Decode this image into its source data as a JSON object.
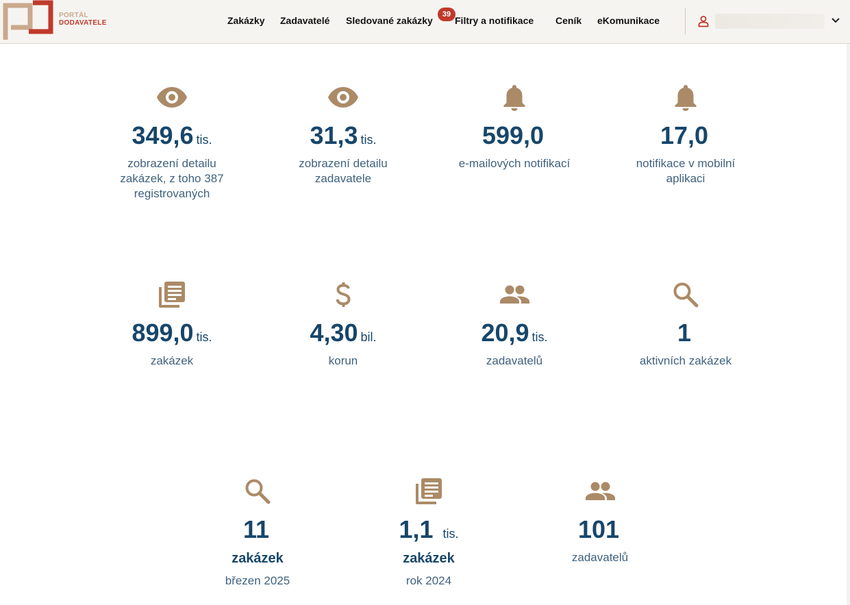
{
  "brand": {
    "line1": "PORTÁL",
    "line2": "DODAVATELE"
  },
  "nav": {
    "items": [
      "Zakázky",
      "Zadavatelé",
      "Sledované zakázky",
      "Filtry a notifikace",
      "Ceník",
      "eKomunikace"
    ],
    "badge": "39"
  },
  "user": {
    "name": ""
  },
  "colors": {
    "accent": "#ab8a67",
    "number": "#17466a",
    "badge": "#c0392b"
  },
  "stats": [
    {
      "icon": "eye-icon",
      "value": "349,6",
      "unit": "tis.",
      "label": "zobrazení detailu zakázek, z toho 387 registrovaných"
    },
    {
      "icon": "eye-icon",
      "value": "31,3",
      "unit": "tis.",
      "label": "zobrazení detailu zadavatele"
    },
    {
      "icon": "bell-icon",
      "value": "599,0",
      "unit": "",
      "label": "e-mailových notifikací"
    },
    {
      "icon": "bell-icon",
      "value": "17,0",
      "unit": "",
      "label": "notifikace v mobilní aplikaci"
    },
    {
      "icon": "document-list-icon",
      "value": "899,0",
      "unit": "tis.",
      "label": "zakázek"
    },
    {
      "icon": "dollar-icon",
      "value": "4,30",
      "unit": "bil.",
      "label": "korun"
    },
    {
      "icon": "people-icon",
      "value": "20,9",
      "unit": "tis.",
      "label": "zadavatelů"
    },
    {
      "icon": "search-icon",
      "value": "1",
      "unit": "",
      "label": "aktivních zakázek"
    },
    {
      "icon": "search-icon",
      "value": "11",
      "unit": "",
      "label": "zakázek",
      "sub": "březen 2025"
    },
    {
      "icon": "document-list-icon",
      "value": "1,1",
      "unit": "tis.",
      "label": "zakázek",
      "sub": "rok 2024"
    },
    {
      "icon": "people-icon",
      "value": "101",
      "unit": "",
      "label": "zadavatelů"
    }
  ]
}
